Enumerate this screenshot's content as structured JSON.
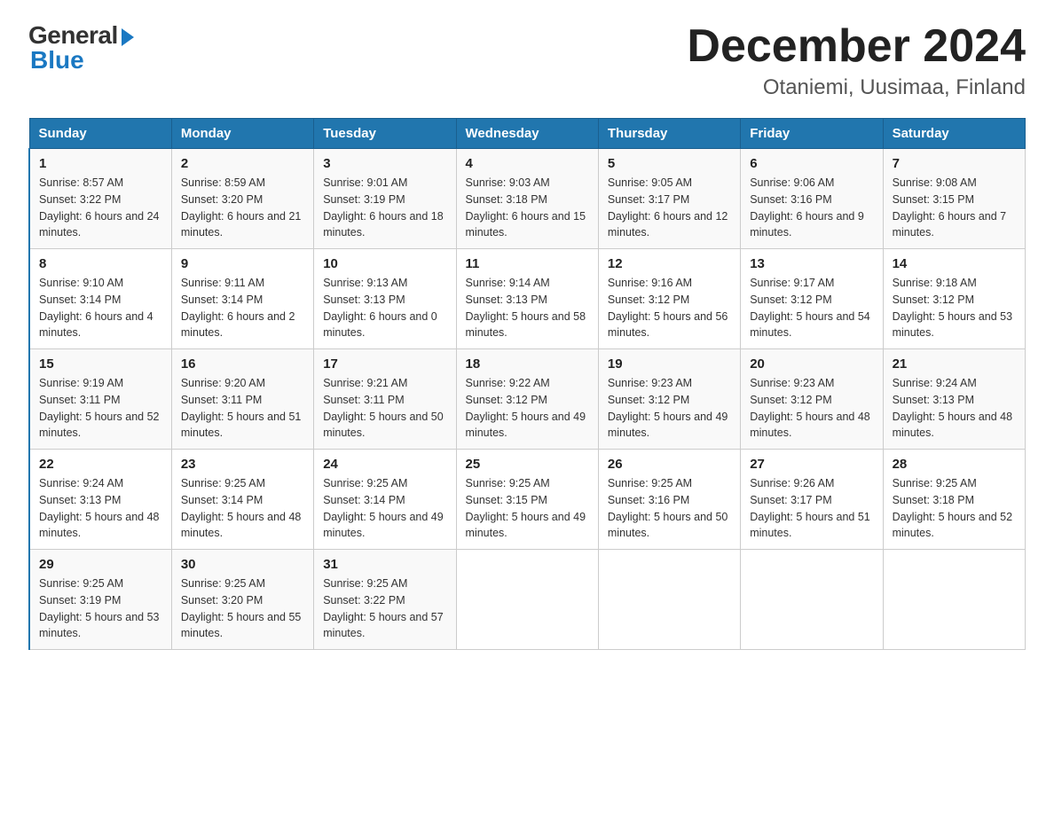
{
  "logo": {
    "general": "General",
    "blue": "Blue"
  },
  "title": "December 2024",
  "location": "Otaniemi, Uusimaa, Finland",
  "headers": [
    "Sunday",
    "Monday",
    "Tuesday",
    "Wednesday",
    "Thursday",
    "Friday",
    "Saturday"
  ],
  "weeks": [
    [
      {
        "day": "1",
        "sunrise": "8:57 AM",
        "sunset": "3:22 PM",
        "daylight": "6 hours and 24 minutes."
      },
      {
        "day": "2",
        "sunrise": "8:59 AM",
        "sunset": "3:20 PM",
        "daylight": "6 hours and 21 minutes."
      },
      {
        "day": "3",
        "sunrise": "9:01 AM",
        "sunset": "3:19 PM",
        "daylight": "6 hours and 18 minutes."
      },
      {
        "day": "4",
        "sunrise": "9:03 AM",
        "sunset": "3:18 PM",
        "daylight": "6 hours and 15 minutes."
      },
      {
        "day": "5",
        "sunrise": "9:05 AM",
        "sunset": "3:17 PM",
        "daylight": "6 hours and 12 minutes."
      },
      {
        "day": "6",
        "sunrise": "9:06 AM",
        "sunset": "3:16 PM",
        "daylight": "6 hours and 9 minutes."
      },
      {
        "day": "7",
        "sunrise": "9:08 AM",
        "sunset": "3:15 PM",
        "daylight": "6 hours and 7 minutes."
      }
    ],
    [
      {
        "day": "8",
        "sunrise": "9:10 AM",
        "sunset": "3:14 PM",
        "daylight": "6 hours and 4 minutes."
      },
      {
        "day": "9",
        "sunrise": "9:11 AM",
        "sunset": "3:14 PM",
        "daylight": "6 hours and 2 minutes."
      },
      {
        "day": "10",
        "sunrise": "9:13 AM",
        "sunset": "3:13 PM",
        "daylight": "6 hours and 0 minutes."
      },
      {
        "day": "11",
        "sunrise": "9:14 AM",
        "sunset": "3:13 PM",
        "daylight": "5 hours and 58 minutes."
      },
      {
        "day": "12",
        "sunrise": "9:16 AM",
        "sunset": "3:12 PM",
        "daylight": "5 hours and 56 minutes."
      },
      {
        "day": "13",
        "sunrise": "9:17 AM",
        "sunset": "3:12 PM",
        "daylight": "5 hours and 54 minutes."
      },
      {
        "day": "14",
        "sunrise": "9:18 AM",
        "sunset": "3:12 PM",
        "daylight": "5 hours and 53 minutes."
      }
    ],
    [
      {
        "day": "15",
        "sunrise": "9:19 AM",
        "sunset": "3:11 PM",
        "daylight": "5 hours and 52 minutes."
      },
      {
        "day": "16",
        "sunrise": "9:20 AM",
        "sunset": "3:11 PM",
        "daylight": "5 hours and 51 minutes."
      },
      {
        "day": "17",
        "sunrise": "9:21 AM",
        "sunset": "3:11 PM",
        "daylight": "5 hours and 50 minutes."
      },
      {
        "day": "18",
        "sunrise": "9:22 AM",
        "sunset": "3:12 PM",
        "daylight": "5 hours and 49 minutes."
      },
      {
        "day": "19",
        "sunrise": "9:23 AM",
        "sunset": "3:12 PM",
        "daylight": "5 hours and 49 minutes."
      },
      {
        "day": "20",
        "sunrise": "9:23 AM",
        "sunset": "3:12 PM",
        "daylight": "5 hours and 48 minutes."
      },
      {
        "day": "21",
        "sunrise": "9:24 AM",
        "sunset": "3:13 PM",
        "daylight": "5 hours and 48 minutes."
      }
    ],
    [
      {
        "day": "22",
        "sunrise": "9:24 AM",
        "sunset": "3:13 PM",
        "daylight": "5 hours and 48 minutes."
      },
      {
        "day": "23",
        "sunrise": "9:25 AM",
        "sunset": "3:14 PM",
        "daylight": "5 hours and 48 minutes."
      },
      {
        "day": "24",
        "sunrise": "9:25 AM",
        "sunset": "3:14 PM",
        "daylight": "5 hours and 49 minutes."
      },
      {
        "day": "25",
        "sunrise": "9:25 AM",
        "sunset": "3:15 PM",
        "daylight": "5 hours and 49 minutes."
      },
      {
        "day": "26",
        "sunrise": "9:25 AM",
        "sunset": "3:16 PM",
        "daylight": "5 hours and 50 minutes."
      },
      {
        "day": "27",
        "sunrise": "9:26 AM",
        "sunset": "3:17 PM",
        "daylight": "5 hours and 51 minutes."
      },
      {
        "day": "28",
        "sunrise": "9:25 AM",
        "sunset": "3:18 PM",
        "daylight": "5 hours and 52 minutes."
      }
    ],
    [
      {
        "day": "29",
        "sunrise": "9:25 AM",
        "sunset": "3:19 PM",
        "daylight": "5 hours and 53 minutes."
      },
      {
        "day": "30",
        "sunrise": "9:25 AM",
        "sunset": "3:20 PM",
        "daylight": "5 hours and 55 minutes."
      },
      {
        "day": "31",
        "sunrise": "9:25 AM",
        "sunset": "3:22 PM",
        "daylight": "5 hours and 57 minutes."
      },
      null,
      null,
      null,
      null
    ]
  ]
}
